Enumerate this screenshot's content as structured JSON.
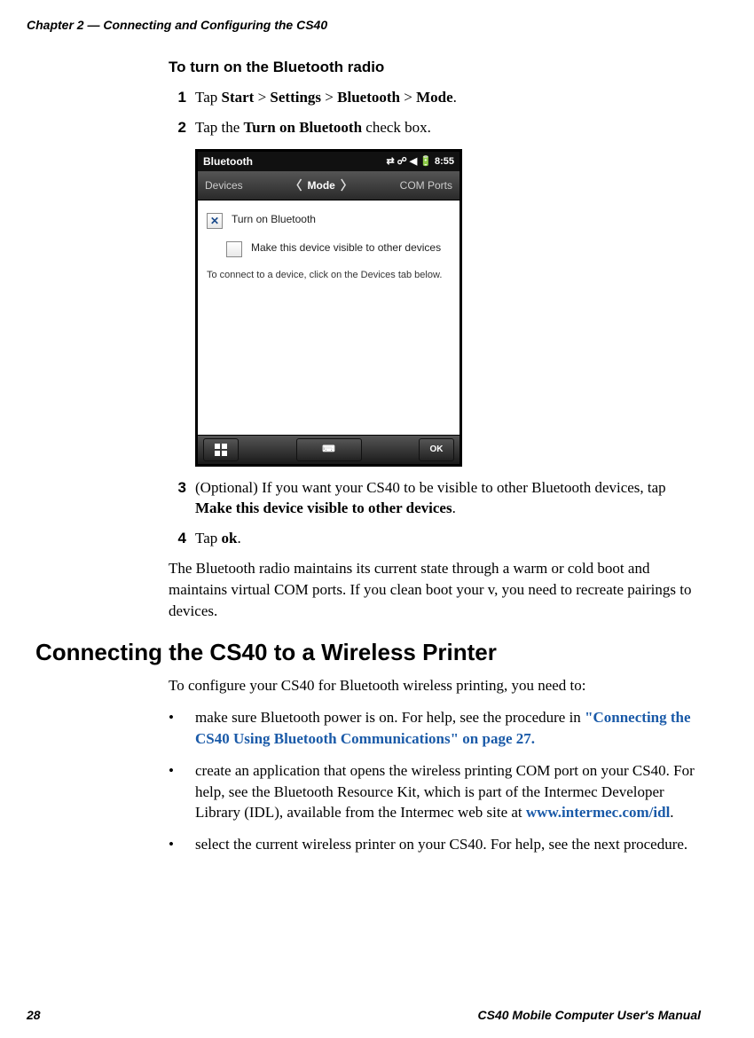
{
  "header": "Chapter 2 — Connecting and Configuring the CS40",
  "section_heading": "To turn on the Bluetooth radio",
  "steps": {
    "s1": {
      "num": "1",
      "lead": "Tap ",
      "b1": "Start",
      "g1": " > ",
      "b2": "Settings",
      "g2": " > ",
      "b3": "Bluetooth",
      "g3": " > ",
      "b4": "Mode",
      "tail": "."
    },
    "s2": {
      "num": "2",
      "lead": "Tap the ",
      "b1": "Turn on Bluetooth",
      "tail": " check box."
    },
    "s3": {
      "num": "3",
      "lead": "(Optional) If you want your CS40 to be visible to other Bluetooth devices, tap ",
      "b1": "Make this device visible to other devices",
      "tail": "."
    },
    "s4": {
      "num": "4",
      "lead": "Tap ",
      "b1": "ok",
      "tail": "."
    }
  },
  "screenshot": {
    "title": "Bluetooth",
    "time": "8:55",
    "tab_left": "Devices",
    "tab_center": "Mode",
    "tab_right": "COM Ports",
    "check1_label": "Turn on Bluetooth",
    "check2_label": "Make this device visible to other devices",
    "hint": "To connect to a device, click on the Devices tab below.",
    "ok_label": "OK"
  },
  "para1": "The Bluetooth radio maintains its current state through a warm or cold boot and maintains virtual COM ports. If you clean boot your v, you need to recreate pairings to devices.",
  "h2": "Connecting the CS40 to a Wireless Printer",
  "intro2": "To configure your CS40 for Bluetooth wireless printing, you need to:",
  "bullets": {
    "b1_lead": "make sure Bluetooth power is on. For help, see the procedure in ",
    "b1_link": "\"Connecting the CS40 Using Bluetooth Communications\" on page 27.",
    "b2_lead": "create an application that opens the wireless printing COM port on your CS40. For help, see the Bluetooth Resource Kit, which is part of the Intermec Developer Library (IDL), available from the Intermec web site at ",
    "b2_link": "www.intermec.com/idl",
    "b2_tail": ".",
    "b3": "select the current wireless printer on your CS40. For help, see the next procedure."
  },
  "footer": {
    "page": "28",
    "title": "CS40 Mobile Computer User's Manual"
  }
}
